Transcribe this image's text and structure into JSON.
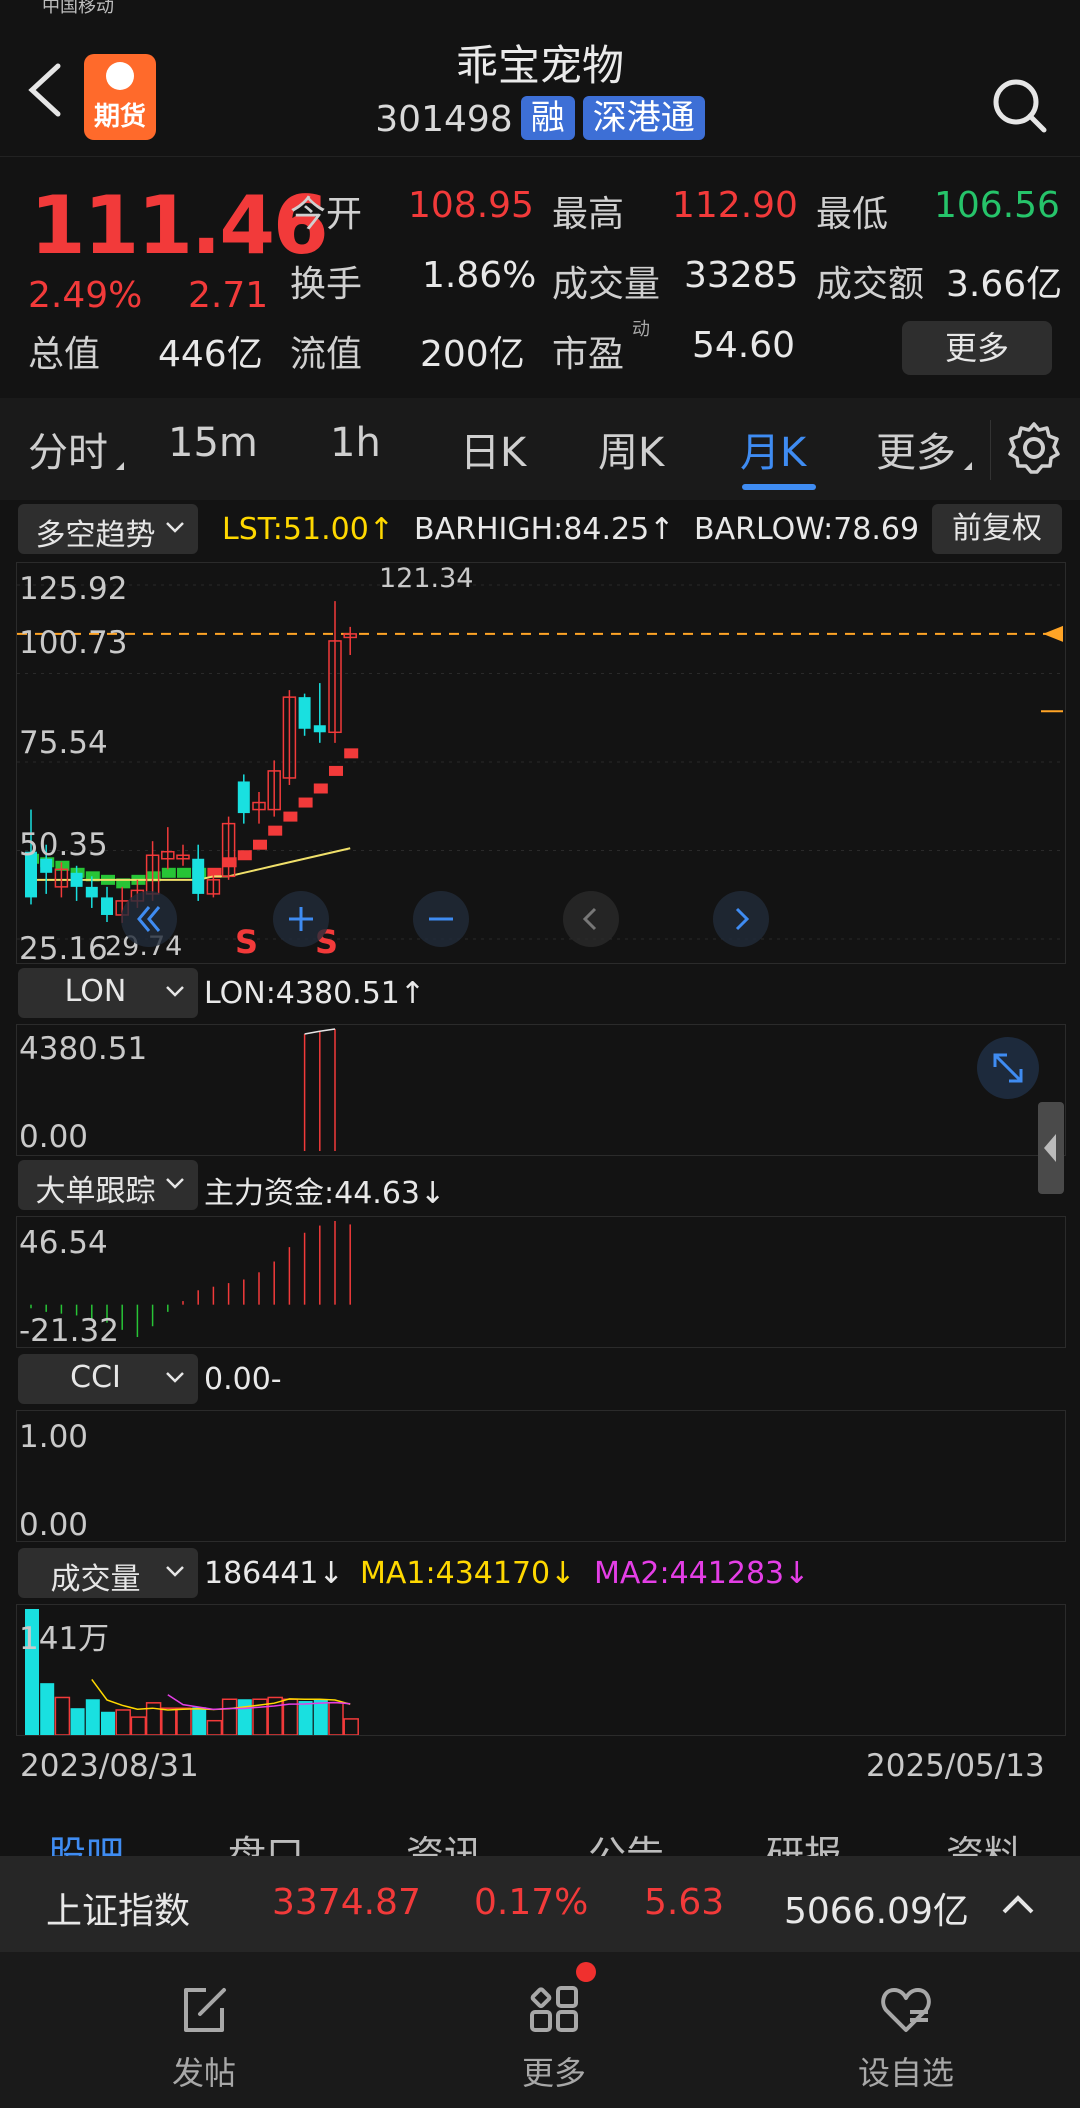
{
  "status_bar": {
    "carrier": "中国移动"
  },
  "header": {
    "logo_text": "期货",
    "title": "乖宝宠物",
    "code": "301498",
    "tags": [
      "融",
      "深港通"
    ]
  },
  "quote": {
    "price": "111.46",
    "change_pct": "2.49%",
    "change": "2.71",
    "labels": {
      "open": "今开",
      "high": "最高",
      "low": "最低",
      "turnover": "换手",
      "volume": "成交量",
      "amount": "成交额",
      "market_cap": "总值",
      "float_cap": "流值",
      "pe": "市盈",
      "pe_sup": "动"
    },
    "values": {
      "open": "108.95",
      "high": "112.90",
      "low": "106.56",
      "turnover": "1.86%",
      "volume": "33285",
      "amount": "3.66亿",
      "market_cap": "446亿",
      "float_cap": "200亿",
      "pe": "54.60"
    },
    "more": "更多"
  },
  "tabs": {
    "items": [
      "分时",
      "15m",
      "1h",
      "日K",
      "周K",
      "月K",
      "更多"
    ],
    "active": "月K"
  },
  "main_chart": {
    "indicator": "多空趋势",
    "lst": "LST:51.00↑",
    "barhigh": "BARHIGH:84.25↑",
    "barlow": "BARLOW:78.69",
    "adjust_button": "前复权",
    "y_labels": [
      "125.92",
      "100.73",
      "75.54",
      "50.35",
      "25.16"
    ],
    "high_label": "121.34",
    "low_label": "29.74",
    "signals": [
      "S",
      "S"
    ],
    "ylim": [
      25.16,
      125.92
    ],
    "candles": [
      {
        "o": 50,
        "c": 37,
        "h": 62,
        "l": 35
      },
      {
        "o": 48,
        "c": 44,
        "h": 52,
        "l": 38
      },
      {
        "o": 40,
        "c": 45,
        "h": 47,
        "l": 37
      },
      {
        "o": 44,
        "c": 40,
        "h": 46,
        "l": 36
      },
      {
        "o": 40,
        "c": 37,
        "h": 43,
        "l": 34
      },
      {
        "o": 37,
        "c": 32,
        "h": 40,
        "l": 30
      },
      {
        "o": 32,
        "c": 36,
        "h": 40,
        "l": 29.74
      },
      {
        "o": 36,
        "c": 39,
        "h": 42,
        "l": 34
      },
      {
        "o": 38,
        "c": 49,
        "h": 53,
        "l": 36
      },
      {
        "o": 48,
        "c": 50,
        "h": 57,
        "l": 45
      },
      {
        "o": 48,
        "c": 49,
        "h": 52,
        "l": 46
      },
      {
        "o": 48,
        "c": 38,
        "h": 52,
        "l": 36
      },
      {
        "o": 38,
        "c": 42,
        "h": 44,
        "l": 37
      },
      {
        "o": 43,
        "c": 58,
        "h": 60,
        "l": 42
      },
      {
        "o": 70,
        "c": 61,
        "h": 72,
        "l": 58
      },
      {
        "o": 62,
        "c": 64,
        "h": 67,
        "l": 58
      },
      {
        "o": 62,
        "c": 73,
        "h": 76,
        "l": 60
      },
      {
        "o": 71,
        "c": 94,
        "h": 96,
        "l": 69
      },
      {
        "o": 94,
        "c": 85,
        "h": 95,
        "l": 83
      },
      {
        "o": 86,
        "c": 84,
        "h": 98,
        "l": 81
      },
      {
        "o": 84,
        "c": 110,
        "h": 121.34,
        "l": 81
      },
      {
        "o": 111,
        "c": 112,
        "h": 114,
        "l": 106
      }
    ],
    "trend_steps": [
      48,
      47,
      46,
      44,
      43,
      42,
      41,
      42,
      43,
      44,
      44,
      44,
      44,
      47,
      49,
      52,
      56,
      60,
      64,
      68,
      73,
      78
    ],
    "ma_line": [
      42,
      42,
      42,
      42,
      42,
      42,
      42,
      42,
      42,
      42,
      42,
      42,
      43,
      43,
      44,
      45,
      46,
      47,
      48,
      49,
      50,
      51
    ],
    "current_price_line": 112
  },
  "lon": {
    "indicator": "LON",
    "value_text": "LON:4380.51↑",
    "y_labels": [
      "4380.51",
      "0.00"
    ],
    "ylim": [
      0,
      4380.51
    ],
    "bars": [
      0,
      0,
      0,
      0,
      0,
      0,
      0,
      0,
      0,
      0,
      0,
      0,
      0,
      0,
      0,
      0,
      0,
      0,
      4200,
      4300,
      4380.51,
      0
    ]
  },
  "big_order": {
    "indicator": "大单跟踪",
    "value_text": "主力资金:44.63↓",
    "y_labels": [
      "46.54",
      "-21.32"
    ],
    "ylim": [
      -21.32,
      46.54
    ],
    "bars": [
      -2,
      -4,
      -5,
      -6,
      -8,
      -10,
      -14,
      -18,
      -12,
      -4,
      2,
      8,
      10,
      12,
      14,
      18,
      24,
      32,
      40,
      44,
      46.54,
      44.63
    ]
  },
  "cci": {
    "indicator": "CCI",
    "value_text": "0.00-",
    "y_labels": [
      "1.00",
      "0.00"
    ]
  },
  "volume": {
    "indicator": "成交量",
    "value_text": "186441↓",
    "ma1": "MA1:434170↓",
    "ma2": "MA2:441283↓",
    "y_label": "141万",
    "ylim": [
      0,
      141
    ],
    "bars": [
      141,
      58,
      42,
      30,
      40,
      26,
      28,
      20,
      36,
      30,
      30,
      31,
      16,
      40,
      40,
      40,
      42,
      40,
      38,
      40,
      36,
      18
    ],
    "x_start": "2023/08/31",
    "x_end": "2025/05/13"
  },
  "bottom_tabs": [
    "股吧",
    "盘口",
    "资讯",
    "公告",
    "研报",
    "资料"
  ],
  "ticker": {
    "name": "上证指数",
    "value": "3374.87",
    "pct": "0.17%",
    "change": "5.63",
    "amount": "5066.09亿"
  },
  "nav": {
    "post": "发帖",
    "more": "更多",
    "watchlist": "设自选"
  },
  "colors": {
    "up": "#f23a3a",
    "down": "#19e0e0",
    "accent": "#3f8cf2",
    "dashed_price": "#ffa426"
  }
}
